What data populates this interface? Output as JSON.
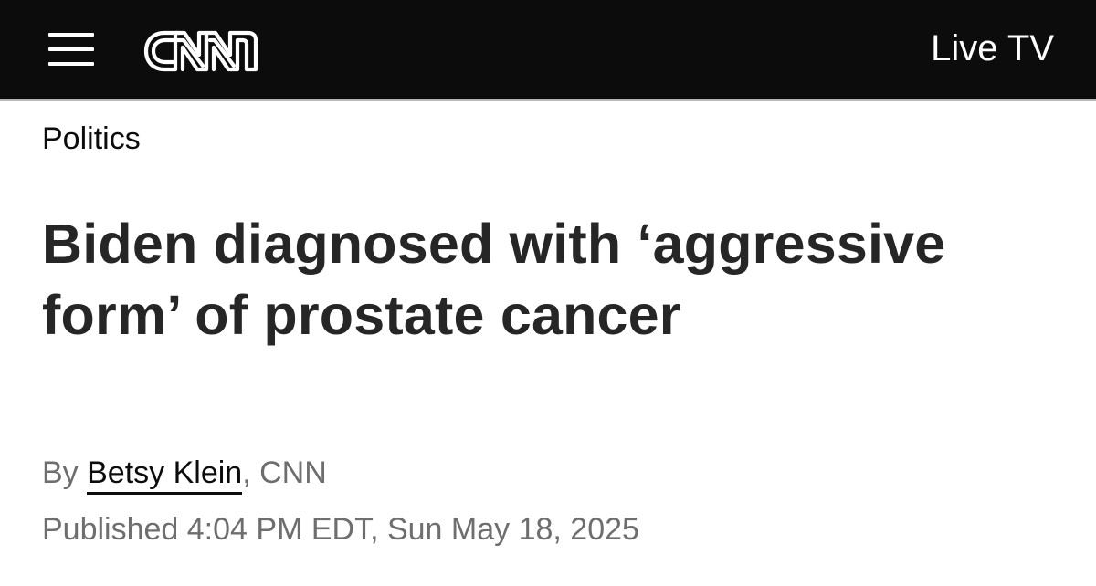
{
  "header": {
    "logo_text": "CNN",
    "live_tv_label": "Live TV"
  },
  "article": {
    "section": "Politics",
    "headline": "Biden diagnosed with ‘aggressive form’ of prostate cancer",
    "byline_prefix": "By ",
    "author": "Betsy Klein",
    "byline_suffix": ", CNN",
    "published": "Published 4:04 PM EDT, Sun May 18, 2025"
  },
  "colors": {
    "header_bg": "#0c0c0c",
    "header_text": "#ffffff",
    "headline_text": "#262626",
    "meta_text": "#6e6e6e"
  },
  "icons": {
    "menu": "hamburger-menu-icon",
    "logo": "cnn-logo"
  }
}
